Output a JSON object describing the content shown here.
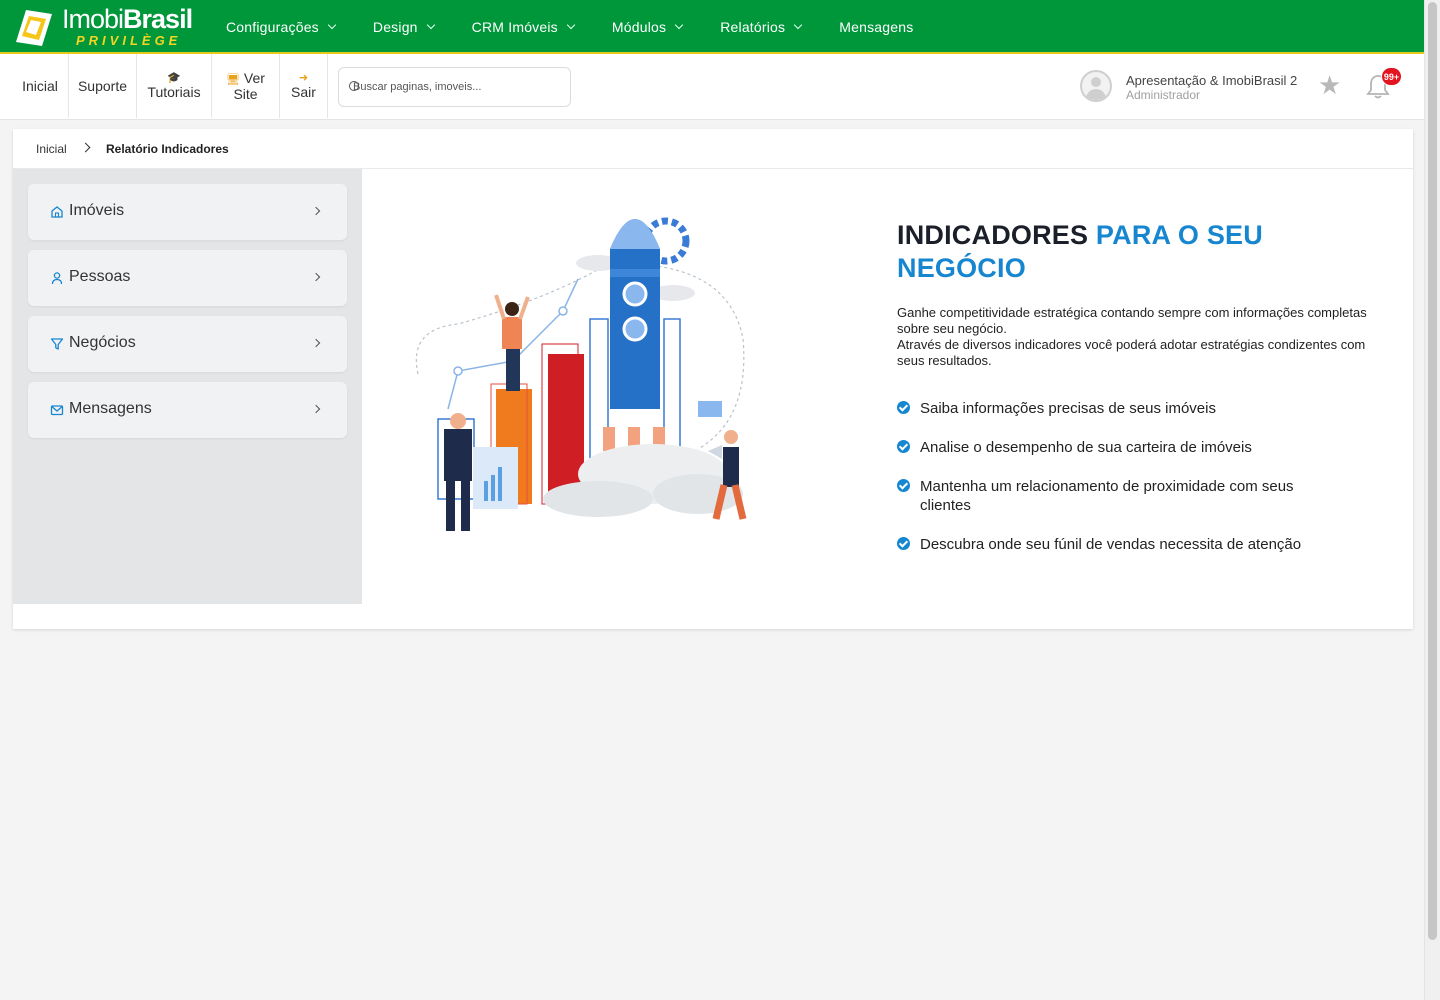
{
  "brand": {
    "name_light": "Imobi",
    "name_bold": "Brasil",
    "tagline": "PRIVILÈGE"
  },
  "main_nav": [
    {
      "label": "Configurações",
      "has_dropdown": true
    },
    {
      "label": "Design",
      "has_dropdown": true
    },
    {
      "label": "CRM Imóveis",
      "has_dropdown": true
    },
    {
      "label": "Módulos",
      "has_dropdown": true
    },
    {
      "label": "Relatórios",
      "has_dropdown": true
    },
    {
      "label": "Mensagens",
      "has_dropdown": false
    }
  ],
  "toolbar": {
    "home": "Inicial",
    "support": "Suporte",
    "tutorials": "Tutoriais",
    "view_site_1": "Ver",
    "view_site_2": "Site",
    "logout": "Sair",
    "search_placeholder": "Buscar paginas, imoveis..."
  },
  "user": {
    "name": "Apresentação & ImobiBrasil 2",
    "role": "Administrador",
    "notification_count": "99+"
  },
  "breadcrumb": {
    "home": "Inicial",
    "current": "Relatório Indicadores"
  },
  "sidebar": {
    "items": [
      {
        "label": "Imóveis",
        "icon": "home-icon"
      },
      {
        "label": "Pessoas",
        "icon": "user-icon"
      },
      {
        "label": "Negócios",
        "icon": "filter-icon"
      },
      {
        "label": "Mensagens",
        "icon": "mail-icon"
      }
    ]
  },
  "hero": {
    "headline_dark": "INDICADORES",
    "headline_blue": "PARA O SEU NEGÓCIO",
    "description_1": "Ganhe competitividade estratégica contando sempre com informações completas sobre seu negócio.",
    "description_2": "Através de diversos indicadores você poderá adotar estratégias condizentes com seus resultados.",
    "features": [
      "Saiba informações precisas de seus imóveis",
      "Analise o desempenho de sua carteira de imóveis",
      "Mantenha um relacionamento de proximidade com seus clientes",
      "Descubra onde seu fúnil de vendas necessita de atenção"
    ]
  },
  "colors": {
    "brand_green": "#00973b",
    "brand_yellow": "#e6c81d",
    "accent_blue": "#1786d0",
    "badge_red": "#e3141f"
  }
}
